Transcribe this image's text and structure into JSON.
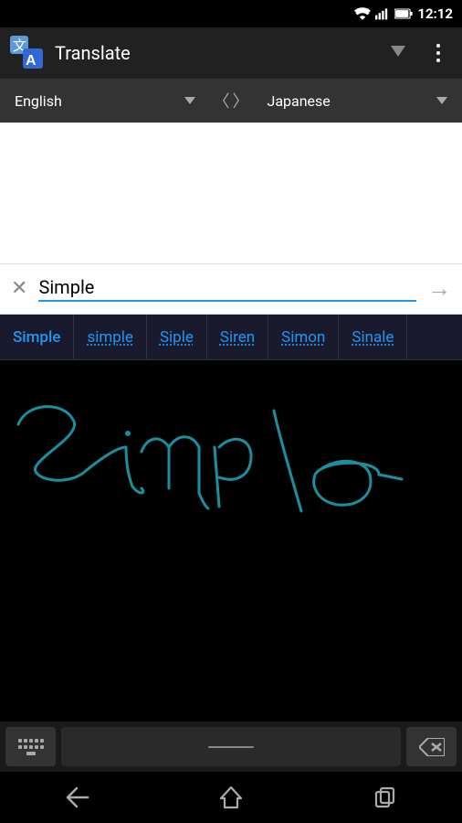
{
  "statusBar": {
    "time": "12:12"
  },
  "appBar": {
    "title": "Translate",
    "overflowLabel": "More options"
  },
  "languageBar": {
    "sourceLang": "English",
    "targetLang": "Japanese",
    "swapChars": "〈 〉"
  },
  "inputArea": {
    "text": "Simple",
    "clearLabel": "×",
    "translateLabel": "→"
  },
  "suggestions": [
    {
      "label": "Simple",
      "style": "normal"
    },
    {
      "label": "simple",
      "style": "dotted"
    },
    {
      "label": "Siple",
      "style": "dotted"
    },
    {
      "label": "Siren",
      "style": "dotted"
    },
    {
      "label": "Simon",
      "style": "dotted"
    },
    {
      "label": "Sinale",
      "style": "dotted"
    }
  ],
  "handwriting": {
    "pathColor": "#1a8fa0",
    "strokeWidth": "3"
  },
  "keyboardBar": {
    "backspaceLabel": "⌫"
  },
  "navBar": {
    "backLabel": "◁",
    "homeLabel": "△",
    "recentLabel": "□"
  }
}
